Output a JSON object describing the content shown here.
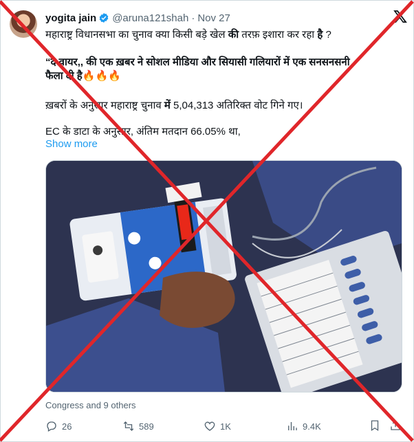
{
  "post": {
    "author_name": "yogita jain",
    "handle": "@aruna121shah",
    "date": "Nov 27",
    "lines": [
      {
        "parts": [
          {
            "t": "महाराष्ट्र विधानसभा का चुनाव क्या किसी बड़े खेल ",
            "b": false
          },
          {
            "t": "की",
            "b": true
          },
          {
            "t": " तरफ़ इशारा कर रहा ",
            "b": false
          },
          {
            "t": "है",
            "b": true
          },
          {
            "t": " ?",
            "b": false
          }
        ]
      },
      {
        "parts": [
          {
            "t": "“द वायर,, की एक ख़बर ने सोशल मीडिया और सियासी गलियारों में एक सनसनसनी",
            "b": true
          }
        ]
      },
      {
        "parts": [
          {
            "t": "फैला दी है",
            "b": true
          },
          {
            "t": "🔥🔥🔥",
            "b": false
          }
        ]
      },
      {
        "parts": [
          {
            "t": "ख़बरों के अनुसार महाराष्ट्र चुनाव ",
            "b": false
          },
          {
            "t": "में",
            "b": true
          },
          {
            "t": " 5,04,313 अतिरिक्त वोट गिने गए।",
            "b": false
          }
        ]
      },
      {
        "parts": [
          {
            "t": "EC के डाटा के अनुसार, अंतिम मतदान 66.05% था,",
            "b": false
          }
        ]
      }
    ],
    "show_more": "Show more",
    "liked_by": "Congress and 9 others"
  },
  "actions": {
    "replies": "26",
    "reposts": "589",
    "likes": "1K",
    "views": "9.4K"
  },
  "icons": [
    "verified-badge-icon",
    "x-logo-icon",
    "reply-icon",
    "repost-icon",
    "like-icon",
    "views-icon",
    "bookmark-icon",
    "share-icon"
  ],
  "colors": {
    "accent": "#1d9bf0",
    "muted": "#536471",
    "cross": "#e0262a",
    "evm_display": "#ff2a1a"
  }
}
